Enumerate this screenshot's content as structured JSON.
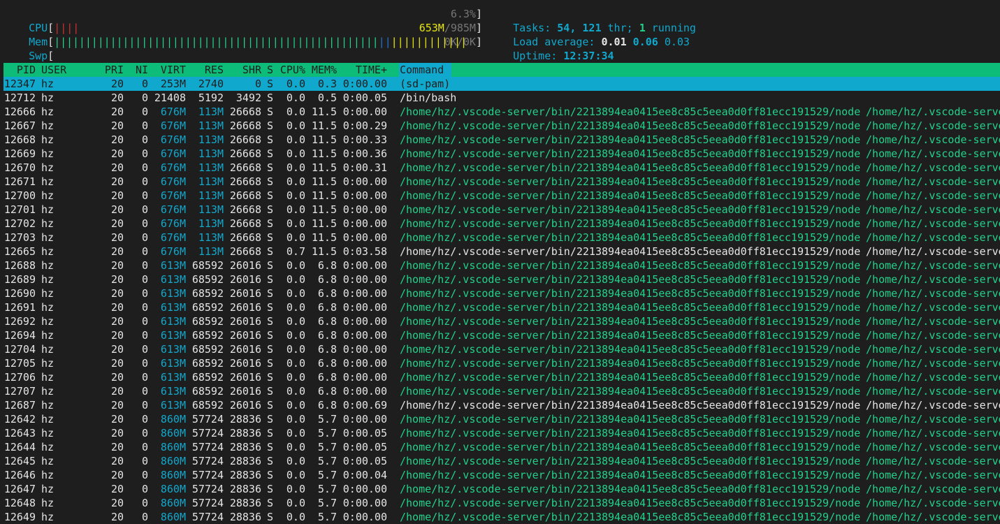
{
  "meters": {
    "cpu": {
      "label": "CPU",
      "bar": "||||",
      "value": "6.3%"
    },
    "mem": {
      "label": "Mem",
      "bar_green": "||||||||||||||||||||||||||||||||||||||||||||||||||||",
      "bar_blue": "||",
      "bar_yellow": "||||||||||||",
      "used": "653M",
      "total": "/985M"
    },
    "swp": {
      "label": "Swp",
      "value": "0K/0K"
    }
  },
  "summary": {
    "tasks_label": "Tasks: ",
    "tasks": "54",
    "sep1": ", ",
    "threads": "121",
    "thr_label": " thr; ",
    "running": "1",
    "running_label": " running",
    "load_label": "Load average: ",
    "load1": "0.01",
    "load5": "0.06",
    "load15": "0.03",
    "uptime_label": "Uptime: ",
    "uptime": "12:37:34"
  },
  "columns": {
    "pid": "PID",
    "user": "USER",
    "pri": "PRI",
    "ni": "NI",
    "virt": "VIRT",
    "res": "RES",
    "shr": "SHR",
    "s": "S",
    "cpu": "CPU%",
    "mem": "MEM%",
    "time": "TIME+",
    "command": "Command"
  },
  "processes": [
    {
      "pid": "12347",
      "user": "hz",
      "pri": "20",
      "ni": "0",
      "virt": "253M",
      "res": "2740",
      "shr": "0",
      "s": "S",
      "cpu": "0.0",
      "mem": "0.3",
      "time": "0:00.00",
      "cmd": "(sd-pam)",
      "args": ""
    },
    {
      "pid": "12712",
      "user": "hz",
      "pri": "20",
      "ni": "0",
      "virt": "21408",
      "res": "5192",
      "shr": "3492",
      "s": "S",
      "cpu": "0.0",
      "mem": "0.5",
      "time": "0:00.05",
      "cmd": "/bin/bash",
      "args": ""
    },
    {
      "pid": "12666",
      "user": "hz",
      "pri": "20",
      "ni": "0",
      "virt": "676M",
      "res": "113M",
      "shr": "26668",
      "s": "S",
      "cpu": "0.0",
      "mem": "11.5",
      "time": "0:00.00",
      "cmd": "/home/hz/.vscode-server/bin/2213894ea0415ee8c85c5eea0d0ff81ecc191529/node",
      "args": " /home/hz/.vscode-server"
    },
    {
      "pid": "12667",
      "user": "hz",
      "pri": "20",
      "ni": "0",
      "virt": "676M",
      "res": "113M",
      "shr": "26668",
      "s": "S",
      "cpu": "0.0",
      "mem": "11.5",
      "time": "0:00.29",
      "cmd": "/home/hz/.vscode-server/bin/2213894ea0415ee8c85c5eea0d0ff81ecc191529/node",
      "args": " /home/hz/.vscode-server"
    },
    {
      "pid": "12668",
      "user": "hz",
      "pri": "20",
      "ni": "0",
      "virt": "676M",
      "res": "113M",
      "shr": "26668",
      "s": "S",
      "cpu": "0.0",
      "mem": "11.5",
      "time": "0:00.33",
      "cmd": "/home/hz/.vscode-server/bin/2213894ea0415ee8c85c5eea0d0ff81ecc191529/node",
      "args": " /home/hz/.vscode-server"
    },
    {
      "pid": "12669",
      "user": "hz",
      "pri": "20",
      "ni": "0",
      "virt": "676M",
      "res": "113M",
      "shr": "26668",
      "s": "S",
      "cpu": "0.0",
      "mem": "11.5",
      "time": "0:00.36",
      "cmd": "/home/hz/.vscode-server/bin/2213894ea0415ee8c85c5eea0d0ff81ecc191529/node",
      "args": " /home/hz/.vscode-server"
    },
    {
      "pid": "12670",
      "user": "hz",
      "pri": "20",
      "ni": "0",
      "virt": "676M",
      "res": "113M",
      "shr": "26668",
      "s": "S",
      "cpu": "0.0",
      "mem": "11.5",
      "time": "0:00.31",
      "cmd": "/home/hz/.vscode-server/bin/2213894ea0415ee8c85c5eea0d0ff81ecc191529/node",
      "args": " /home/hz/.vscode-server"
    },
    {
      "pid": "12671",
      "user": "hz",
      "pri": "20",
      "ni": "0",
      "virt": "676M",
      "res": "113M",
      "shr": "26668",
      "s": "S",
      "cpu": "0.0",
      "mem": "11.5",
      "time": "0:00.00",
      "cmd": "/home/hz/.vscode-server/bin/2213894ea0415ee8c85c5eea0d0ff81ecc191529/node",
      "args": " /home/hz/.vscode-server"
    },
    {
      "pid": "12700",
      "user": "hz",
      "pri": "20",
      "ni": "0",
      "virt": "676M",
      "res": "113M",
      "shr": "26668",
      "s": "S",
      "cpu": "0.0",
      "mem": "11.5",
      "time": "0:00.00",
      "cmd": "/home/hz/.vscode-server/bin/2213894ea0415ee8c85c5eea0d0ff81ecc191529/node",
      "args": " /home/hz/.vscode-server"
    },
    {
      "pid": "12701",
      "user": "hz",
      "pri": "20",
      "ni": "0",
      "virt": "676M",
      "res": "113M",
      "shr": "26668",
      "s": "S",
      "cpu": "0.0",
      "mem": "11.5",
      "time": "0:00.00",
      "cmd": "/home/hz/.vscode-server/bin/2213894ea0415ee8c85c5eea0d0ff81ecc191529/node",
      "args": " /home/hz/.vscode-server"
    },
    {
      "pid": "12702",
      "user": "hz",
      "pri": "20",
      "ni": "0",
      "virt": "676M",
      "res": "113M",
      "shr": "26668",
      "s": "S",
      "cpu": "0.0",
      "mem": "11.5",
      "time": "0:00.00",
      "cmd": "/home/hz/.vscode-server/bin/2213894ea0415ee8c85c5eea0d0ff81ecc191529/node",
      "args": " /home/hz/.vscode-server"
    },
    {
      "pid": "12703",
      "user": "hz",
      "pri": "20",
      "ni": "0",
      "virt": "676M",
      "res": "113M",
      "shr": "26668",
      "s": "S",
      "cpu": "0.0",
      "mem": "11.5",
      "time": "0:00.00",
      "cmd": "/home/hz/.vscode-server/bin/2213894ea0415ee8c85c5eea0d0ff81ecc191529/node",
      "args": " /home/hz/.vscode-server"
    },
    {
      "pid": "12665",
      "user": "hz",
      "pri": "20",
      "ni": "0",
      "virt": "676M",
      "res": "113M",
      "shr": "26668",
      "s": "S",
      "cpu": "0.7",
      "mem": "11.5",
      "time": "0:03.58",
      "cmd": "/home/hz/.vscode-server/bin/2213894ea0415ee8c85c5eea0d0ff81ecc191529/node",
      "args": " /home/hz/.vscode-server"
    },
    {
      "pid": "12688",
      "user": "hz",
      "pri": "20",
      "ni": "0",
      "virt": "613M",
      "res": "68592",
      "shr": "26016",
      "s": "S",
      "cpu": "0.0",
      "mem": "6.8",
      "time": "0:00.00",
      "cmd": "/home/hz/.vscode-server/bin/2213894ea0415ee8c85c5eea0d0ff81ecc191529/node",
      "args": " /home/hz/.vscode-server"
    },
    {
      "pid": "12689",
      "user": "hz",
      "pri": "20",
      "ni": "0",
      "virt": "613M",
      "res": "68592",
      "shr": "26016",
      "s": "S",
      "cpu": "0.0",
      "mem": "6.8",
      "time": "0:00.00",
      "cmd": "/home/hz/.vscode-server/bin/2213894ea0415ee8c85c5eea0d0ff81ecc191529/node",
      "args": " /home/hz/.vscode-server"
    },
    {
      "pid": "12690",
      "user": "hz",
      "pri": "20",
      "ni": "0",
      "virt": "613M",
      "res": "68592",
      "shr": "26016",
      "s": "S",
      "cpu": "0.0",
      "mem": "6.8",
      "time": "0:00.00",
      "cmd": "/home/hz/.vscode-server/bin/2213894ea0415ee8c85c5eea0d0ff81ecc191529/node",
      "args": " /home/hz/.vscode-server"
    },
    {
      "pid": "12691",
      "user": "hz",
      "pri": "20",
      "ni": "0",
      "virt": "613M",
      "res": "68592",
      "shr": "26016",
      "s": "S",
      "cpu": "0.0",
      "mem": "6.8",
      "time": "0:00.00",
      "cmd": "/home/hz/.vscode-server/bin/2213894ea0415ee8c85c5eea0d0ff81ecc191529/node",
      "args": " /home/hz/.vscode-server"
    },
    {
      "pid": "12692",
      "user": "hz",
      "pri": "20",
      "ni": "0",
      "virt": "613M",
      "res": "68592",
      "shr": "26016",
      "s": "S",
      "cpu": "0.0",
      "mem": "6.8",
      "time": "0:00.00",
      "cmd": "/home/hz/.vscode-server/bin/2213894ea0415ee8c85c5eea0d0ff81ecc191529/node",
      "args": " /home/hz/.vscode-server"
    },
    {
      "pid": "12694",
      "user": "hz",
      "pri": "20",
      "ni": "0",
      "virt": "613M",
      "res": "68592",
      "shr": "26016",
      "s": "S",
      "cpu": "0.0",
      "mem": "6.8",
      "time": "0:00.00",
      "cmd": "/home/hz/.vscode-server/bin/2213894ea0415ee8c85c5eea0d0ff81ecc191529/node",
      "args": " /home/hz/.vscode-server"
    },
    {
      "pid": "12704",
      "user": "hz",
      "pri": "20",
      "ni": "0",
      "virt": "613M",
      "res": "68592",
      "shr": "26016",
      "s": "S",
      "cpu": "0.0",
      "mem": "6.8",
      "time": "0:00.00",
      "cmd": "/home/hz/.vscode-server/bin/2213894ea0415ee8c85c5eea0d0ff81ecc191529/node",
      "args": " /home/hz/.vscode-server"
    },
    {
      "pid": "12705",
      "user": "hz",
      "pri": "20",
      "ni": "0",
      "virt": "613M",
      "res": "68592",
      "shr": "26016",
      "s": "S",
      "cpu": "0.0",
      "mem": "6.8",
      "time": "0:00.00",
      "cmd": "/home/hz/.vscode-server/bin/2213894ea0415ee8c85c5eea0d0ff81ecc191529/node",
      "args": " /home/hz/.vscode-server"
    },
    {
      "pid": "12706",
      "user": "hz",
      "pri": "20",
      "ni": "0",
      "virt": "613M",
      "res": "68592",
      "shr": "26016",
      "s": "S",
      "cpu": "0.0",
      "mem": "6.8",
      "time": "0:00.00",
      "cmd": "/home/hz/.vscode-server/bin/2213894ea0415ee8c85c5eea0d0ff81ecc191529/node",
      "args": " /home/hz/.vscode-server"
    },
    {
      "pid": "12707",
      "user": "hz",
      "pri": "20",
      "ni": "0",
      "virt": "613M",
      "res": "68592",
      "shr": "26016",
      "s": "S",
      "cpu": "0.0",
      "mem": "6.8",
      "time": "0:00.00",
      "cmd": "/home/hz/.vscode-server/bin/2213894ea0415ee8c85c5eea0d0ff81ecc191529/node",
      "args": " /home/hz/.vscode-server"
    },
    {
      "pid": "12687",
      "user": "hz",
      "pri": "20",
      "ni": "0",
      "virt": "613M",
      "res": "68592",
      "shr": "26016",
      "s": "S",
      "cpu": "0.0",
      "mem": "6.8",
      "time": "0:00.69",
      "cmd": "/home/hz/.vscode-server/bin/2213894ea0415ee8c85c5eea0d0ff81ecc191529/node",
      "args": " /home/hz/.vscode-server"
    },
    {
      "pid": "12642",
      "user": "hz",
      "pri": "20",
      "ni": "0",
      "virt": "860M",
      "res": "57724",
      "shr": "28836",
      "s": "S",
      "cpu": "0.0",
      "mem": "5.7",
      "time": "0:00.00",
      "cmd": "/home/hz/.vscode-server/bin/2213894ea0415ee8c85c5eea0d0ff81ecc191529/node",
      "args": " /home/hz/.vscode-server"
    },
    {
      "pid": "12643",
      "user": "hz",
      "pri": "20",
      "ni": "0",
      "virt": "860M",
      "res": "57724",
      "shr": "28836",
      "s": "S",
      "cpu": "0.0",
      "mem": "5.7",
      "time": "0:00.05",
      "cmd": "/home/hz/.vscode-server/bin/2213894ea0415ee8c85c5eea0d0ff81ecc191529/node",
      "args": " /home/hz/.vscode-server"
    },
    {
      "pid": "12644",
      "user": "hz",
      "pri": "20",
      "ni": "0",
      "virt": "860M",
      "res": "57724",
      "shr": "28836",
      "s": "S",
      "cpu": "0.0",
      "mem": "5.7",
      "time": "0:00.05",
      "cmd": "/home/hz/.vscode-server/bin/2213894ea0415ee8c85c5eea0d0ff81ecc191529/node",
      "args": " /home/hz/.vscode-server"
    },
    {
      "pid": "12645",
      "user": "hz",
      "pri": "20",
      "ni": "0",
      "virt": "860M",
      "res": "57724",
      "shr": "28836",
      "s": "S",
      "cpu": "0.0",
      "mem": "5.7",
      "time": "0:00.05",
      "cmd": "/home/hz/.vscode-server/bin/2213894ea0415ee8c85c5eea0d0ff81ecc191529/node",
      "args": " /home/hz/.vscode-server"
    },
    {
      "pid": "12646",
      "user": "hz",
      "pri": "20",
      "ni": "0",
      "virt": "860M",
      "res": "57724",
      "shr": "28836",
      "s": "S",
      "cpu": "0.0",
      "mem": "5.7",
      "time": "0:00.04",
      "cmd": "/home/hz/.vscode-server/bin/2213894ea0415ee8c85c5eea0d0ff81ecc191529/node",
      "args": " /home/hz/.vscode-server"
    },
    {
      "pid": "12647",
      "user": "hz",
      "pri": "20",
      "ni": "0",
      "virt": "860M",
      "res": "57724",
      "shr": "28836",
      "s": "S",
      "cpu": "0.0",
      "mem": "5.7",
      "time": "0:00.00",
      "cmd": "/home/hz/.vscode-server/bin/2213894ea0415ee8c85c5eea0d0ff81ecc191529/node",
      "args": " /home/hz/.vscode-server"
    },
    {
      "pid": "12648",
      "user": "hz",
      "pri": "20",
      "ni": "0",
      "virt": "860M",
      "res": "57724",
      "shr": "28836",
      "s": "S",
      "cpu": "0.0",
      "mem": "5.7",
      "time": "0:00.00",
      "cmd": "/home/hz/.vscode-server/bin/2213894ea0415ee8c85c5eea0d0ff81ecc191529/node",
      "args": " /home/hz/.vscode-server"
    },
    {
      "pid": "12649",
      "user": "hz",
      "pri": "20",
      "ni": "0",
      "virt": "860M",
      "res": "57724",
      "shr": "28836",
      "s": "S",
      "cpu": "0.0",
      "mem": "5.7",
      "time": "0:00.00",
      "cmd": "/home/hz/.vscode-server/bin/2213894ea0415ee8c85c5eea0d0ff81ecc191529/node",
      "args": " /home/hz/.vscode-server"
    }
  ],
  "process_styles": {
    "selected_pid": "12347",
    "thread_pids_note_color": "#23d18b",
    "main_text_color": "#e5e5e5",
    "highlight_color": "#11a8cd",
    "header_color": "#0dbc79"
  }
}
